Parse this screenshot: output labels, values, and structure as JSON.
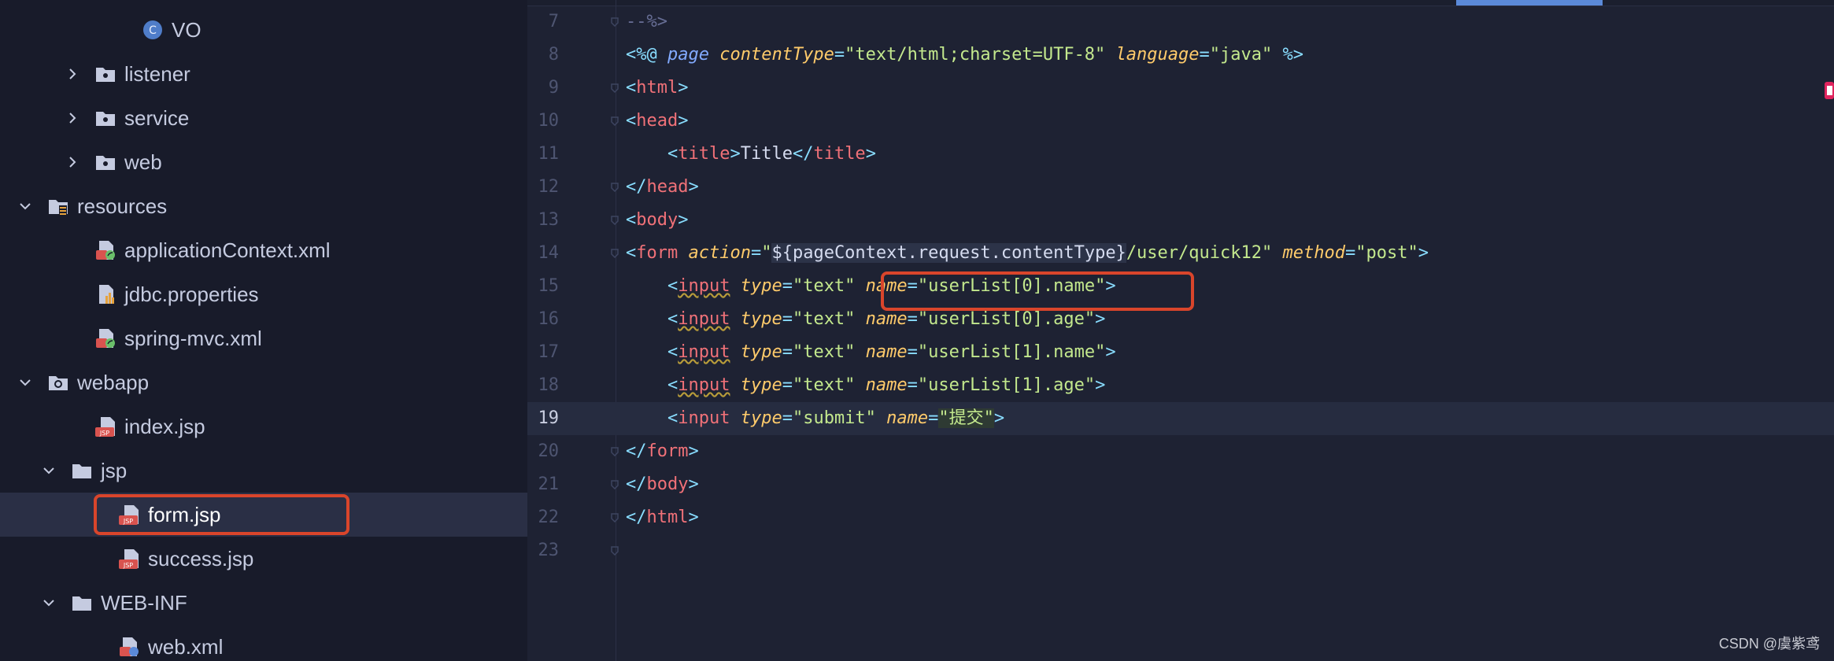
{
  "project_tree": {
    "items": [
      {
        "label": "VO",
        "icon": "class-icon",
        "expanded": null
      },
      {
        "label": "listener",
        "icon": "package-folder-icon",
        "expanded": false
      },
      {
        "label": "service",
        "icon": "package-folder-icon",
        "expanded": false
      },
      {
        "label": "web",
        "icon": "package-folder-icon",
        "expanded": false
      },
      {
        "label": "resources",
        "icon": "resources-folder-icon",
        "expanded": true
      },
      {
        "label": "applicationContext.xml",
        "icon": "spring-xml-icon",
        "expanded": null
      },
      {
        "label": "jdbc.properties",
        "icon": "properties-file-icon",
        "expanded": null
      },
      {
        "label": "spring-mvc.xml",
        "icon": "spring-xml-icon",
        "expanded": null
      },
      {
        "label": "webapp",
        "icon": "web-folder-icon",
        "expanded": true
      },
      {
        "label": "index.jsp",
        "icon": "jsp-file-icon",
        "expanded": null
      },
      {
        "label": "jsp",
        "icon": "folder-icon",
        "expanded": true
      },
      {
        "label": "form.jsp",
        "icon": "jsp-file-icon",
        "expanded": null,
        "selected": true
      },
      {
        "label": "success.jsp",
        "icon": "jsp-file-icon",
        "expanded": null
      },
      {
        "label": "WEB-INF",
        "icon": "folder-icon",
        "expanded": true
      },
      {
        "label": "web.xml",
        "icon": "web-xml-icon",
        "expanded": null
      }
    ]
  },
  "editor": {
    "current_line": "19",
    "lines": [
      {
        "n": "7",
        "tokens": [
          {
            "c": "t-com",
            "t": "--%>"
          }
        ]
      },
      {
        "n": "8",
        "tokens": [
          {
            "c": "t-br",
            "t": "<%@ "
          },
          {
            "c": "t-dir",
            "t": "page "
          },
          {
            "c": "t-attr",
            "t": "contentType"
          },
          {
            "c": "t-eq",
            "t": "="
          },
          {
            "c": "t-str",
            "t": "\"text/html;charset=UTF-8\" "
          },
          {
            "c": "t-attr",
            "t": "language"
          },
          {
            "c": "t-eq",
            "t": "="
          },
          {
            "c": "t-str",
            "t": "\"java\" "
          },
          {
            "c": "t-br",
            "t": "%>"
          }
        ]
      },
      {
        "n": "9",
        "tokens": [
          {
            "c": "t-br",
            "t": "<"
          },
          {
            "c": "t-tag",
            "t": "html"
          },
          {
            "c": "t-br",
            "t": ">"
          }
        ]
      },
      {
        "n": "10",
        "tokens": [
          {
            "c": "t-br",
            "t": "<"
          },
          {
            "c": "t-tag",
            "t": "head"
          },
          {
            "c": "t-br",
            "t": ">"
          }
        ]
      },
      {
        "n": "11",
        "tokens": [
          {
            "c": "t-txt",
            "t": "    "
          },
          {
            "c": "t-br",
            "t": "<"
          },
          {
            "c": "t-tag",
            "t": "title"
          },
          {
            "c": "t-br",
            "t": ">"
          },
          {
            "c": "t-txt",
            "t": "Title"
          },
          {
            "c": "t-br",
            "t": "</"
          },
          {
            "c": "t-tag",
            "t": "title"
          },
          {
            "c": "t-br",
            "t": ">"
          }
        ]
      },
      {
        "n": "12",
        "tokens": [
          {
            "c": "t-br",
            "t": "</"
          },
          {
            "c": "t-tag",
            "t": "head"
          },
          {
            "c": "t-br",
            "t": ">"
          }
        ]
      },
      {
        "n": "13",
        "tokens": [
          {
            "c": "t-br",
            "t": "<"
          },
          {
            "c": "t-tag",
            "t": "body"
          },
          {
            "c": "t-br",
            "t": ">"
          }
        ]
      },
      {
        "n": "14",
        "tokens": [
          {
            "c": "t-br",
            "t": "<"
          },
          {
            "c": "t-tag",
            "t": "form "
          },
          {
            "c": "t-attr",
            "t": "action"
          },
          {
            "c": "t-eq",
            "t": "="
          },
          {
            "c": "t-str",
            "t": "\""
          },
          {
            "c": "t-el",
            "t": "${pageContext.request.contentType}"
          },
          {
            "c": "t-str",
            "t": "/user/quick12\" "
          },
          {
            "c": "t-attr",
            "t": "method"
          },
          {
            "c": "t-eq",
            "t": "="
          },
          {
            "c": "t-str",
            "t": "\"post\""
          },
          {
            "c": "t-br",
            "t": ">"
          }
        ]
      },
      {
        "n": "15",
        "tokens": [
          {
            "c": "t-txt",
            "t": "    "
          },
          {
            "c": "t-br",
            "t": "<"
          },
          {
            "c": "t-tag t-sq",
            "t": "input"
          },
          {
            "c": "t-txt",
            "t": " "
          },
          {
            "c": "t-attr",
            "t": "type"
          },
          {
            "c": "t-eq",
            "t": "="
          },
          {
            "c": "t-str",
            "t": "\"text\" "
          },
          {
            "c": "t-attr",
            "t": "name"
          },
          {
            "c": "t-eq",
            "t": "="
          },
          {
            "c": "t-str",
            "t": "\"userList[0].name\""
          },
          {
            "c": "t-br",
            "t": ">"
          }
        ]
      },
      {
        "n": "16",
        "tokens": [
          {
            "c": "t-txt",
            "t": "    "
          },
          {
            "c": "t-br",
            "t": "<"
          },
          {
            "c": "t-tag t-sq",
            "t": "input"
          },
          {
            "c": "t-txt",
            "t": " "
          },
          {
            "c": "t-attr",
            "t": "type"
          },
          {
            "c": "t-eq",
            "t": "="
          },
          {
            "c": "t-str",
            "t": "\"text\" "
          },
          {
            "c": "t-attr",
            "t": "name"
          },
          {
            "c": "t-eq",
            "t": "="
          },
          {
            "c": "t-str",
            "t": "\"userList[0].age\""
          },
          {
            "c": "t-br",
            "t": ">"
          }
        ]
      },
      {
        "n": "17",
        "tokens": [
          {
            "c": "t-txt",
            "t": "    "
          },
          {
            "c": "t-br",
            "t": "<"
          },
          {
            "c": "t-tag t-sq",
            "t": "input"
          },
          {
            "c": "t-txt",
            "t": " "
          },
          {
            "c": "t-attr",
            "t": "type"
          },
          {
            "c": "t-eq",
            "t": "="
          },
          {
            "c": "t-str",
            "t": "\"text\" "
          },
          {
            "c": "t-attr",
            "t": "name"
          },
          {
            "c": "t-eq",
            "t": "="
          },
          {
            "c": "t-str",
            "t": "\"userList[1].name\""
          },
          {
            "c": "t-br",
            "t": ">"
          }
        ]
      },
      {
        "n": "18",
        "tokens": [
          {
            "c": "t-txt",
            "t": "    "
          },
          {
            "c": "t-br",
            "t": "<"
          },
          {
            "c": "t-tag t-sq",
            "t": "input"
          },
          {
            "c": "t-txt",
            "t": " "
          },
          {
            "c": "t-attr",
            "t": "type"
          },
          {
            "c": "t-eq",
            "t": "="
          },
          {
            "c": "t-str",
            "t": "\"text\" "
          },
          {
            "c": "t-attr",
            "t": "name"
          },
          {
            "c": "t-eq",
            "t": "="
          },
          {
            "c": "t-str",
            "t": "\"userList[1].age\""
          },
          {
            "c": "t-br",
            "t": ">"
          }
        ]
      },
      {
        "n": "19",
        "tokens": [
          {
            "c": "t-txt",
            "t": "    "
          },
          {
            "c": "t-br",
            "t": "<"
          },
          {
            "c": "t-tag",
            "t": "input"
          },
          {
            "c": "t-txt",
            "t": " "
          },
          {
            "c": "t-attr",
            "t": "type"
          },
          {
            "c": "t-eq",
            "t": "="
          },
          {
            "c": "t-str",
            "t": "\"submit\" "
          },
          {
            "c": "t-attr",
            "t": "name"
          },
          {
            "c": "t-eq",
            "t": "="
          },
          {
            "c": "t-str t-sel",
            "t": "\"提交\""
          },
          {
            "c": "t-br",
            "t": ">"
          }
        ]
      },
      {
        "n": "20",
        "tokens": [
          {
            "c": "t-br",
            "t": "</"
          },
          {
            "c": "t-tag",
            "t": "form"
          },
          {
            "c": "t-br",
            "t": ">"
          }
        ]
      },
      {
        "n": "21",
        "tokens": [
          {
            "c": "t-br",
            "t": "</"
          },
          {
            "c": "t-tag",
            "t": "body"
          },
          {
            "c": "t-br",
            "t": ">"
          }
        ]
      },
      {
        "n": "22",
        "tokens": [
          {
            "c": "t-br",
            "t": "</"
          },
          {
            "c": "t-tag",
            "t": "html"
          },
          {
            "c": "t-br",
            "t": ">"
          }
        ]
      },
      {
        "n": "23",
        "tokens": []
      }
    ]
  },
  "watermark": "CSDN @虞紫鸢",
  "colors": {
    "highlight_box": "#d9452b",
    "background": "#1e2233",
    "sidebar_background": "#181b2a"
  }
}
